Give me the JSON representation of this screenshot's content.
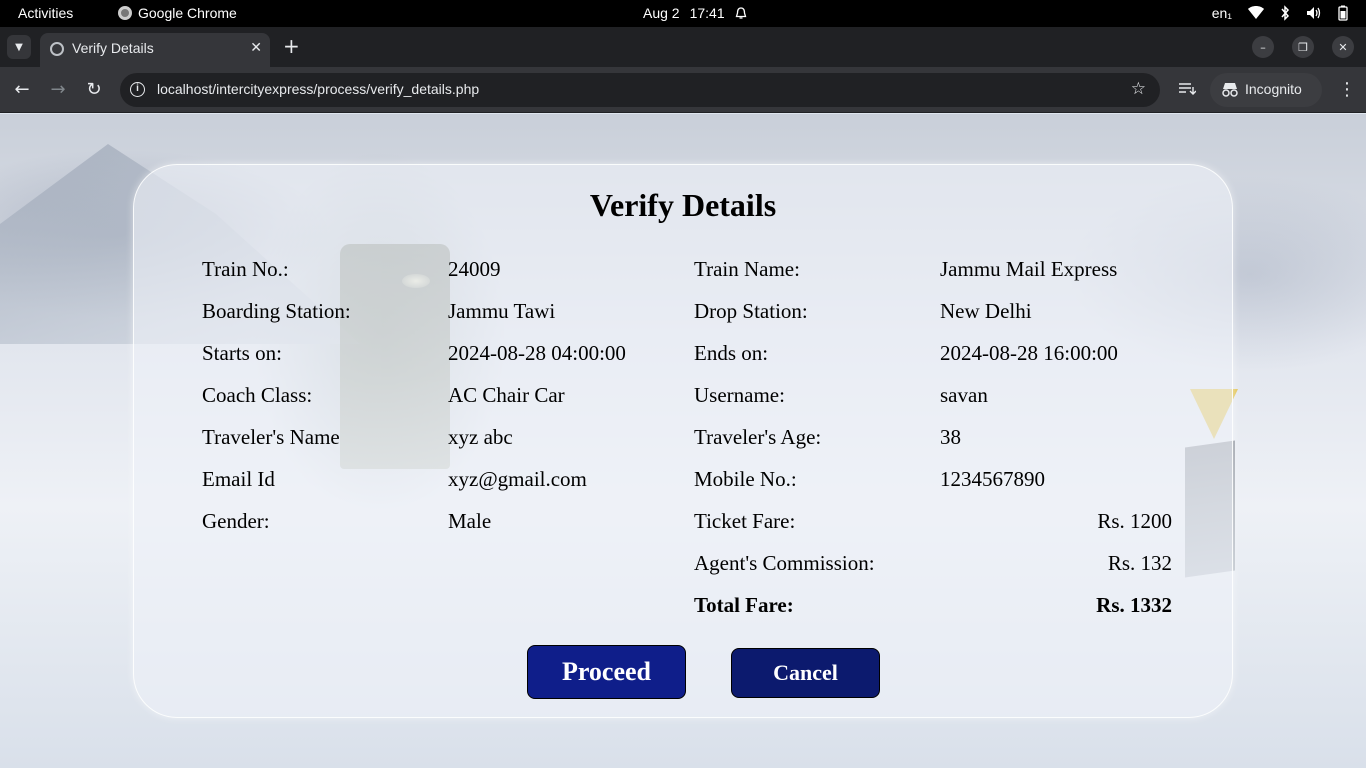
{
  "system_bar": {
    "activities": "Activities",
    "app_name": "Google Chrome",
    "date": "Aug 2",
    "time": "17:41",
    "lang": "en₁"
  },
  "browser": {
    "tab_title": "Verify Details",
    "url": "localhost/intercityexpress/process/verify_details.php",
    "incognito_label": "Incognito"
  },
  "page": {
    "title": "Verify Details",
    "left_rows": [
      {
        "label": "Train No.:",
        "value": "24009"
      },
      {
        "label": "Boarding Station:",
        "value": "Jammu Tawi"
      },
      {
        "label": "Starts on:",
        "value": "2024-08-28 04:00:00"
      },
      {
        "label": "Coach Class:",
        "value": "AC Chair Car"
      },
      {
        "label": "Traveler's Name",
        "value": "xyz abc"
      },
      {
        "label": "Email Id",
        "value": "xyz@gmail.com"
      },
      {
        "label": "Gender:",
        "value": "Male"
      }
    ],
    "right_rows": [
      {
        "label": "Train Name:",
        "value": "Jammu Mail Express"
      },
      {
        "label": "Drop Station:",
        "value": "New Delhi"
      },
      {
        "label": "Ends on:",
        "value": "2024-08-28 16:00:00"
      },
      {
        "label": "Username:",
        "value": "savan"
      },
      {
        "label": "Traveler's Age:",
        "value": "38"
      },
      {
        "label": "Mobile No.:",
        "value": "1234567890"
      }
    ],
    "fare_rows": [
      {
        "label": "Ticket Fare:",
        "value": "Rs. 1200"
      },
      {
        "label": "Agent's Commission:",
        "value": "Rs. 132"
      },
      {
        "label": "Total Fare:",
        "value": "Rs. 1332"
      }
    ],
    "proceed_label": "Proceed",
    "cancel_label": "Cancel"
  }
}
